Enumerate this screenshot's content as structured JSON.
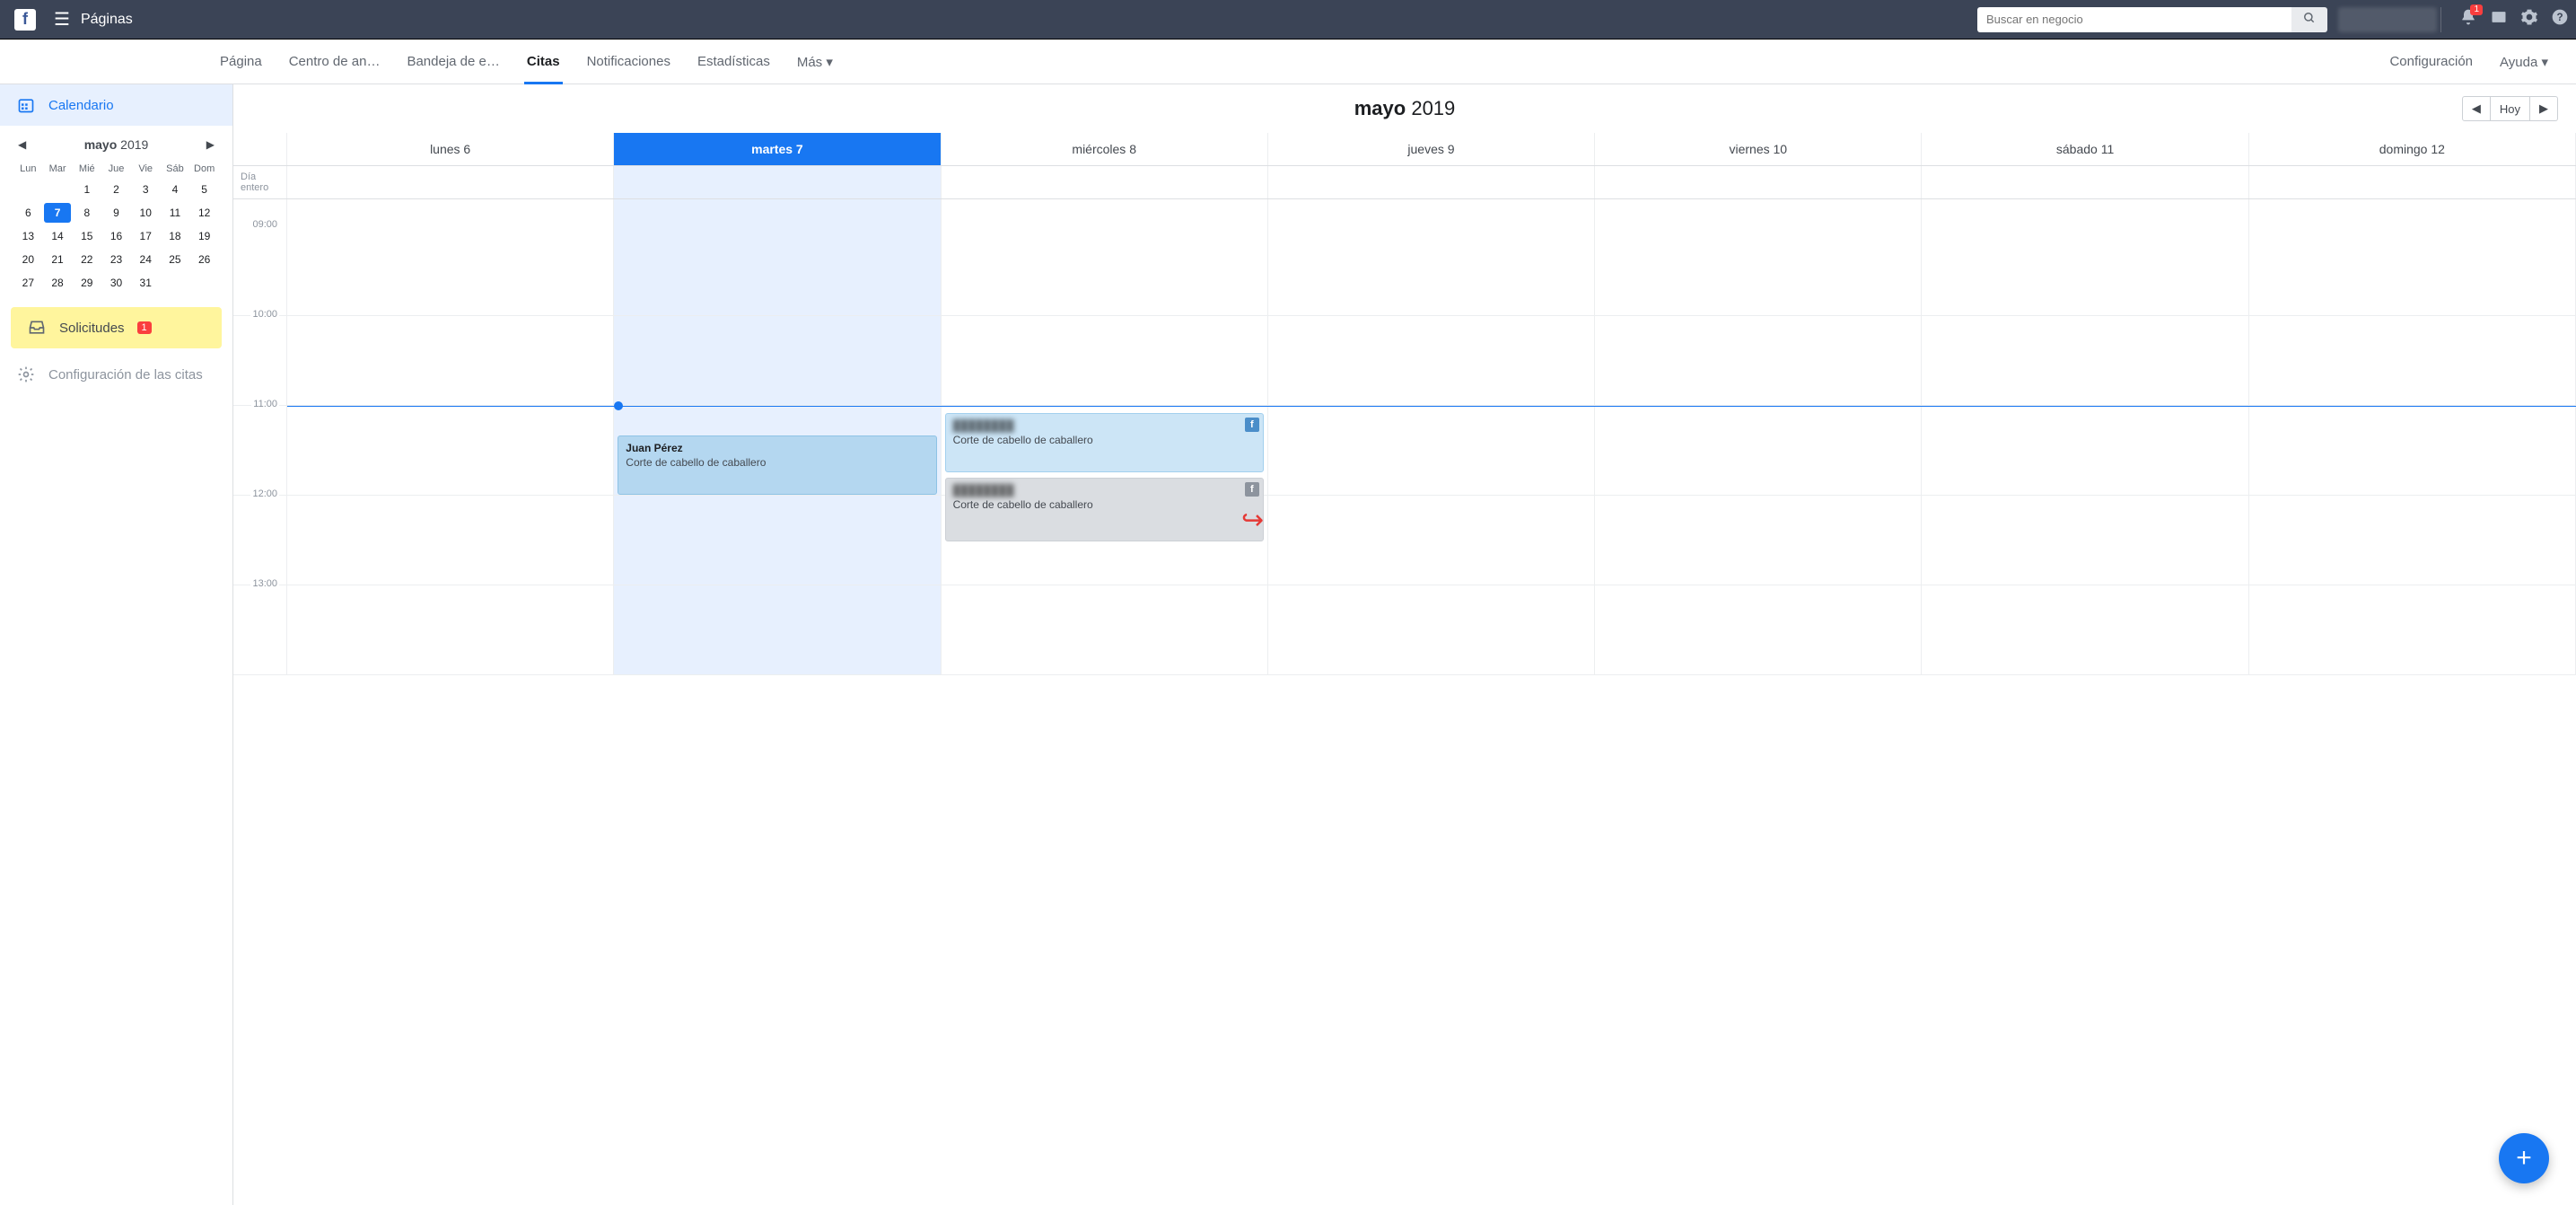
{
  "topbar": {
    "title": "Páginas",
    "search_placeholder": "Buscar en negocio",
    "notif_count": "1"
  },
  "nav": {
    "tabs": [
      "Página",
      "Centro de an…",
      "Bandeja de e…",
      "Citas",
      "Notificaciones",
      "Estadísticas",
      "Más ▾"
    ],
    "active_index": 3,
    "config": "Configuración",
    "help": "Ayuda ▾"
  },
  "sidebar": {
    "calendar_label": "Calendario",
    "mini_cal": {
      "month_bold": "mayo",
      "month_rest": "2019",
      "dow": [
        "Lun",
        "Mar",
        "Mié",
        "Jue",
        "Vie",
        "Sáb",
        "Dom"
      ],
      "leading_blanks": 2,
      "selected": 7,
      "days_in_month": 31
    },
    "requests_label": "Solicitudes",
    "requests_count": "1",
    "settings_label": "Configuración de las citas"
  },
  "calendar": {
    "title_bold": "mayo",
    "title_rest": "2019",
    "today_btn": "Hoy",
    "allday_label": "Día entero",
    "today_index": 1,
    "days": [
      "lunes 6",
      "martes 7",
      "miércoles 8",
      "jueves 9",
      "viernes 10",
      "sábado 11",
      "domingo 12"
    ],
    "hours": [
      "09:00",
      "10:00",
      "11:00",
      "12:00",
      "13:00"
    ],
    "now_hour": 2,
    "events": {
      "tue": {
        "title": "Juan Pérez",
        "desc": "Corte de cabello de caballero"
      },
      "wed1": {
        "title_blur": "████████",
        "desc": "Corte de cabello de caballero"
      },
      "wed2": {
        "title_blur": "████████",
        "desc": "Corte de cabello de caballero"
      }
    }
  }
}
